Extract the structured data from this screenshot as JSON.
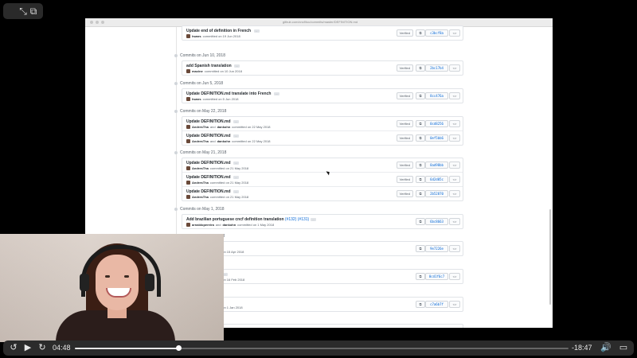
{
  "top_controls": {
    "fullscreen_icon": "expand-arrows-icon",
    "pip_icon": "picture-in-picture-icon"
  },
  "browser": {
    "url": "github.com/cncf/toc/commits/master/DEFINITION.md"
  },
  "commit_groups": [
    {
      "date": "",
      "commits": [
        {
          "title": "Update end of definition in French",
          "author": "hwars",
          "meta": "committed on 19 Jun 2018",
          "verified": "Verified",
          "sha": "c3bcf8a"
        }
      ]
    },
    {
      "date": "Commits on Jun 10, 2018",
      "commits": [
        {
          "title": "add Spanish translation",
          "author": "macine",
          "meta": "committed on 10 Jun 2018",
          "verified": "Verified",
          "sha": "2bc17b4"
        }
      ]
    },
    {
      "date": "Commits on Jun 5, 2018",
      "commits": [
        {
          "title": "Update DEFINITION.md translate into French",
          "author": "hwars",
          "meta": "committed on 5 Jun 2018",
          "verified": "Verified",
          "sha": "8cc476a"
        }
      ]
    },
    {
      "date": "Commits on May 22, 2018",
      "commits": [
        {
          "title": "Update DEFINITION.md",
          "author": "AndresTha",
          "coauthor": "dankohn",
          "meta": "committed on 22 May 2018",
          "verified": "Verified",
          "sha": "0cd8256"
        },
        {
          "title": "Update DEFINITION.md",
          "author": "AndresTha",
          "coauthor": "dankohn",
          "meta": "committed on 22 May 2018",
          "verified": "Verified",
          "sha": "0ef5bb6"
        }
      ]
    },
    {
      "date": "Commits on May 21, 2018",
      "commits": [
        {
          "title": "Update DEFINITION.md",
          "author": "AndresTha",
          "meta": "committed on 21 May 2018",
          "verified": "Verified",
          "sha": "8ad98bb"
        },
        {
          "title": "Update DEFINITION.md",
          "author": "AndresTha",
          "meta": "committed on 21 May 2018",
          "verified": "Verified",
          "sha": "6d2d05c"
        },
        {
          "title": "Update DEFINITION.md",
          "author": "AndresTha",
          "meta": "committed on 21 May 2018",
          "verified": "Verified",
          "sha": "2b52870"
        }
      ]
    },
    {
      "date": "Commits on May 1, 2018",
      "commits": [
        {
          "title": "Add brazilian portuguese cncf definition translation",
          "pr": "(#132) (#131)",
          "author": "arnaldopereira",
          "coauthor": "dankohn",
          "meta": "committed on 1 May 2018",
          "sha": "6bc8663"
        }
      ]
    },
    {
      "date": "Commits on Apr 16, 2018",
      "commits": [
        {
          "title": "",
          "pr": "(#122)",
          "author": "dankohn",
          "meta": "committed on 15 Apr 2018",
          "sha": "9e7226e"
        }
      ]
    },
    {
      "date": "",
      "commits": [
        {
          "title": "n definition",
          "pr": "(#103)",
          "author": "dankohn",
          "meta": "committed on 16 Feb 2018",
          "sha": "0cd1f6c7"
        }
      ]
    },
    {
      "date": "",
      "commits": [
        {
          "title": "e format",
          "pr": "(#185)",
          "author": "dankohn",
          "meta": "committed on 1 Jan 2018",
          "sha": "c7a6b7f"
        }
      ]
    },
    {
      "date": "",
      "commits": [
        {
          "title": "ase",
          "author": "",
          "meta": "8 Jun 2018",
          "verified": "Verified",
          "sha": "c6692a6"
        }
      ]
    }
  ],
  "player": {
    "current_time": "04:48",
    "remaining_time": "-18:47",
    "progress": 0.21,
    "skip_back_label": "15",
    "skip_forward_label": "15"
  }
}
